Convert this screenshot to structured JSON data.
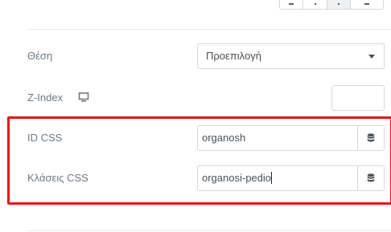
{
  "position": {
    "label": "Θέση",
    "selected": "Προεπιλογή"
  },
  "zindex": {
    "label": "Z-Index",
    "device_icon": "desktop-monitor-icon",
    "value": ""
  },
  "css_id": {
    "label": "ID CSS",
    "value": "organosh",
    "dynamic_icon": "database-icon"
  },
  "css_classes": {
    "label": "Κλάσεις CSS",
    "value": "organosi-pedio",
    "dynamic_icon": "database-icon"
  },
  "colors": {
    "highlight": "#e8141c",
    "label": "#6d7882",
    "input_text": "#495157",
    "border": "#d5d8dc"
  }
}
